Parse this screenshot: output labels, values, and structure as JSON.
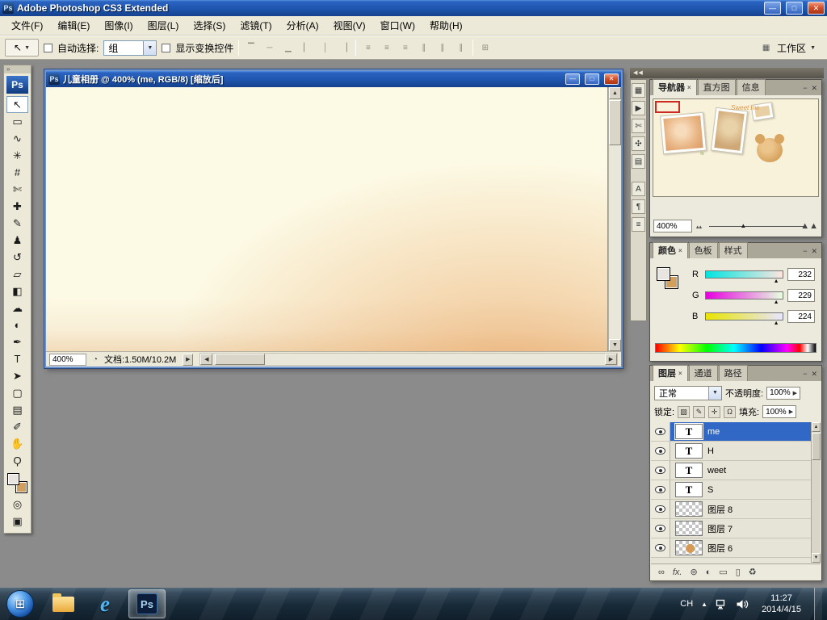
{
  "app": {
    "title": "Adobe Photoshop CS3 Extended",
    "logo": "Ps"
  },
  "window_controls": {
    "minimize": "—",
    "maximize": "□",
    "close": "✕"
  },
  "panel_controls": {
    "collapse": "−",
    "close": "✕",
    "tab_close": "×"
  },
  "scrollbar": {
    "up": "▲",
    "down": "▼",
    "left": "◀",
    "right": "▶"
  },
  "caret": "▼",
  "menu": {
    "items": [
      "文件(F)",
      "编辑(E)",
      "图像(I)",
      "图层(L)",
      "选择(S)",
      "滤镜(T)",
      "分析(A)",
      "视图(V)",
      "窗口(W)",
      "帮助(H)"
    ]
  },
  "options": {
    "tool_preset_icon": "↖",
    "auto_select_label": "自动选择:",
    "auto_select_value": "组",
    "show_transform_label": "显示变换控件",
    "align_icons": [
      {
        "name": "align-top-edges",
        "glyph": "▔"
      },
      {
        "name": "align-vertical-centers",
        "glyph": "─"
      },
      {
        "name": "align-bottom-edges",
        "glyph": "▁"
      },
      {
        "name": "align-left-edges",
        "glyph": "▏"
      },
      {
        "name": "align-horizontal-centers",
        "glyph": "│"
      },
      {
        "name": "align-right-edges",
        "glyph": "▕"
      }
    ],
    "distribute_icons": [
      {
        "name": "distribute-top-edges",
        "glyph": "≡"
      },
      {
        "name": "distribute-vertical-centers",
        "glyph": "≡"
      },
      {
        "name": "distribute-bottom-edges",
        "glyph": "≡"
      },
      {
        "name": "distribute-left-edges",
        "glyph": "∥"
      },
      {
        "name": "distribute-horizontal-centers",
        "glyph": "∥"
      },
      {
        "name": "distribute-right-edges",
        "glyph": "∥"
      }
    ],
    "auto_align_icon": "⊞",
    "workspace_icon": "▦",
    "workspace_label": "工作区"
  },
  "toolbox": {
    "collapse_icon": "»",
    "logo": "Ps",
    "tools": [
      {
        "name": "move-tool",
        "glyph": "↖"
      },
      {
        "name": "rectangular-marquee-tool",
        "glyph": "▭"
      },
      {
        "name": "lasso-tool",
        "glyph": "∿"
      },
      {
        "name": "quick-selection-tool",
        "glyph": "✳"
      },
      {
        "name": "crop-tool",
        "glyph": "#"
      },
      {
        "name": "slice-tool",
        "glyph": "✄"
      },
      {
        "name": "healing-brush-tool",
        "glyph": "✚"
      },
      {
        "name": "brush-tool",
        "glyph": "✎"
      },
      {
        "name": "clone-stamp-tool",
        "glyph": "♟"
      },
      {
        "name": "history-brush-tool",
        "glyph": "↺"
      },
      {
        "name": "eraser-tool",
        "glyph": "▱"
      },
      {
        "name": "gradient-tool",
        "glyph": "◧"
      },
      {
        "name": "blur-tool",
        "glyph": "☁"
      },
      {
        "name": "dodge-tool",
        "glyph": "◐"
      },
      {
        "name": "pen-tool",
        "glyph": "✒"
      },
      {
        "name": "type-tool",
        "glyph": "T"
      },
      {
        "name": "path-selection-tool",
        "glyph": "➤"
      },
      {
        "name": "shape-tool",
        "glyph": "▢"
      },
      {
        "name": "notes-tool",
        "glyph": "▤"
      },
      {
        "name": "eyedropper-tool",
        "glyph": "✐"
      },
      {
        "name": "hand-tool",
        "glyph": "✋"
      },
      {
        "name": "zoom-tool",
        "glyph": "Ϙ"
      }
    ],
    "foreground_color": "#E8E5E0",
    "background_color": "#D2A05E",
    "quick_mask_icon": "◎",
    "screen_mode_icon": "▣"
  },
  "document": {
    "icon": "Ps",
    "title": "儿童相册 @ 400% (me, RGB/8) [缩放后]",
    "zoom": "400%",
    "timing_icon": "◔",
    "info": "文档:1.50M/10.2M",
    "popup_icon": "▶"
  },
  "dock": {
    "collapse_icon": "◀◀",
    "strip_icons": [
      {
        "name": "histogram-panel-icon",
        "glyph": "▦"
      },
      {
        "name": "actions-panel-icon",
        "glyph": "▶"
      },
      {
        "name": "tool-presets-panel-icon",
        "glyph": "✄"
      },
      {
        "name": "clone-source-panel-icon",
        "glyph": "✣"
      },
      {
        "name": "layer-comps-panel-icon",
        "glyph": "▤"
      },
      {
        "name": "character-panel-icon",
        "glyph": "A"
      },
      {
        "name": "paragraph-panel-icon",
        "glyph": "¶"
      },
      {
        "name": "styles-panel-icon",
        "glyph": "≡"
      }
    ]
  },
  "navigator": {
    "tabs": [
      "导航器",
      "直方图",
      "信息"
    ],
    "artwork_text": "Sweet me",
    "scribble": "≈",
    "zoom": "400%",
    "zoom_out_icon": "▴▴",
    "zoom_in_icon": "▲▲",
    "slider_thumb_icon": "▲"
  },
  "color": {
    "tabs": [
      "颜色",
      "色板",
      "样式"
    ],
    "thumb_icon": "▲",
    "channels": [
      {
        "label": "R",
        "value": "232"
      },
      {
        "label": "G",
        "value": "229"
      },
      {
        "label": "B",
        "value": "224"
      }
    ]
  },
  "layers": {
    "tabs": [
      "图层",
      "通道",
      "路径"
    ],
    "blend_mode": "正常",
    "opacity_label": "不透明度:",
    "opacity_value": "100%",
    "lock_label": "锁定:",
    "fill_label": "填充:",
    "fill_value": "100%",
    "lock_icons": [
      {
        "name": "lock-transparent-pixels-icon",
        "glyph": "▨"
      },
      {
        "name": "lock-image-pixels-icon",
        "glyph": "✎"
      },
      {
        "name": "lock-position-icon",
        "glyph": "✛"
      },
      {
        "name": "lock-all-icon",
        "glyph": "Ω"
      }
    ],
    "text_thumb_glyph": "T",
    "items": [
      {
        "name": "me"
      },
      {
        "name": "H"
      },
      {
        "name": "weet"
      },
      {
        "name": "S"
      },
      {
        "name": "图层 8"
      },
      {
        "name": "图层 7"
      },
      {
        "name": "图层 6"
      }
    ],
    "bottom_icons": [
      {
        "name": "link-layers-icon",
        "glyph": "∞"
      },
      {
        "name": "layer-style-icon",
        "glyph": "fx."
      },
      {
        "name": "layer-mask-icon",
        "glyph": "⊚"
      },
      {
        "name": "adjustment-layer-icon",
        "glyph": "◐"
      },
      {
        "name": "layer-group-icon",
        "glyph": "▭"
      },
      {
        "name": "new-layer-icon",
        "glyph": "▯"
      },
      {
        "name": "delete-layer-icon",
        "glyph": "♻"
      }
    ]
  },
  "taskbar": {
    "start_icon": "⊞",
    "ie_label": "e",
    "ps_label": "Ps",
    "language": "CH",
    "hidden_icons_icon": "▲",
    "time": "11:27",
    "date": "2014/4/15"
  }
}
